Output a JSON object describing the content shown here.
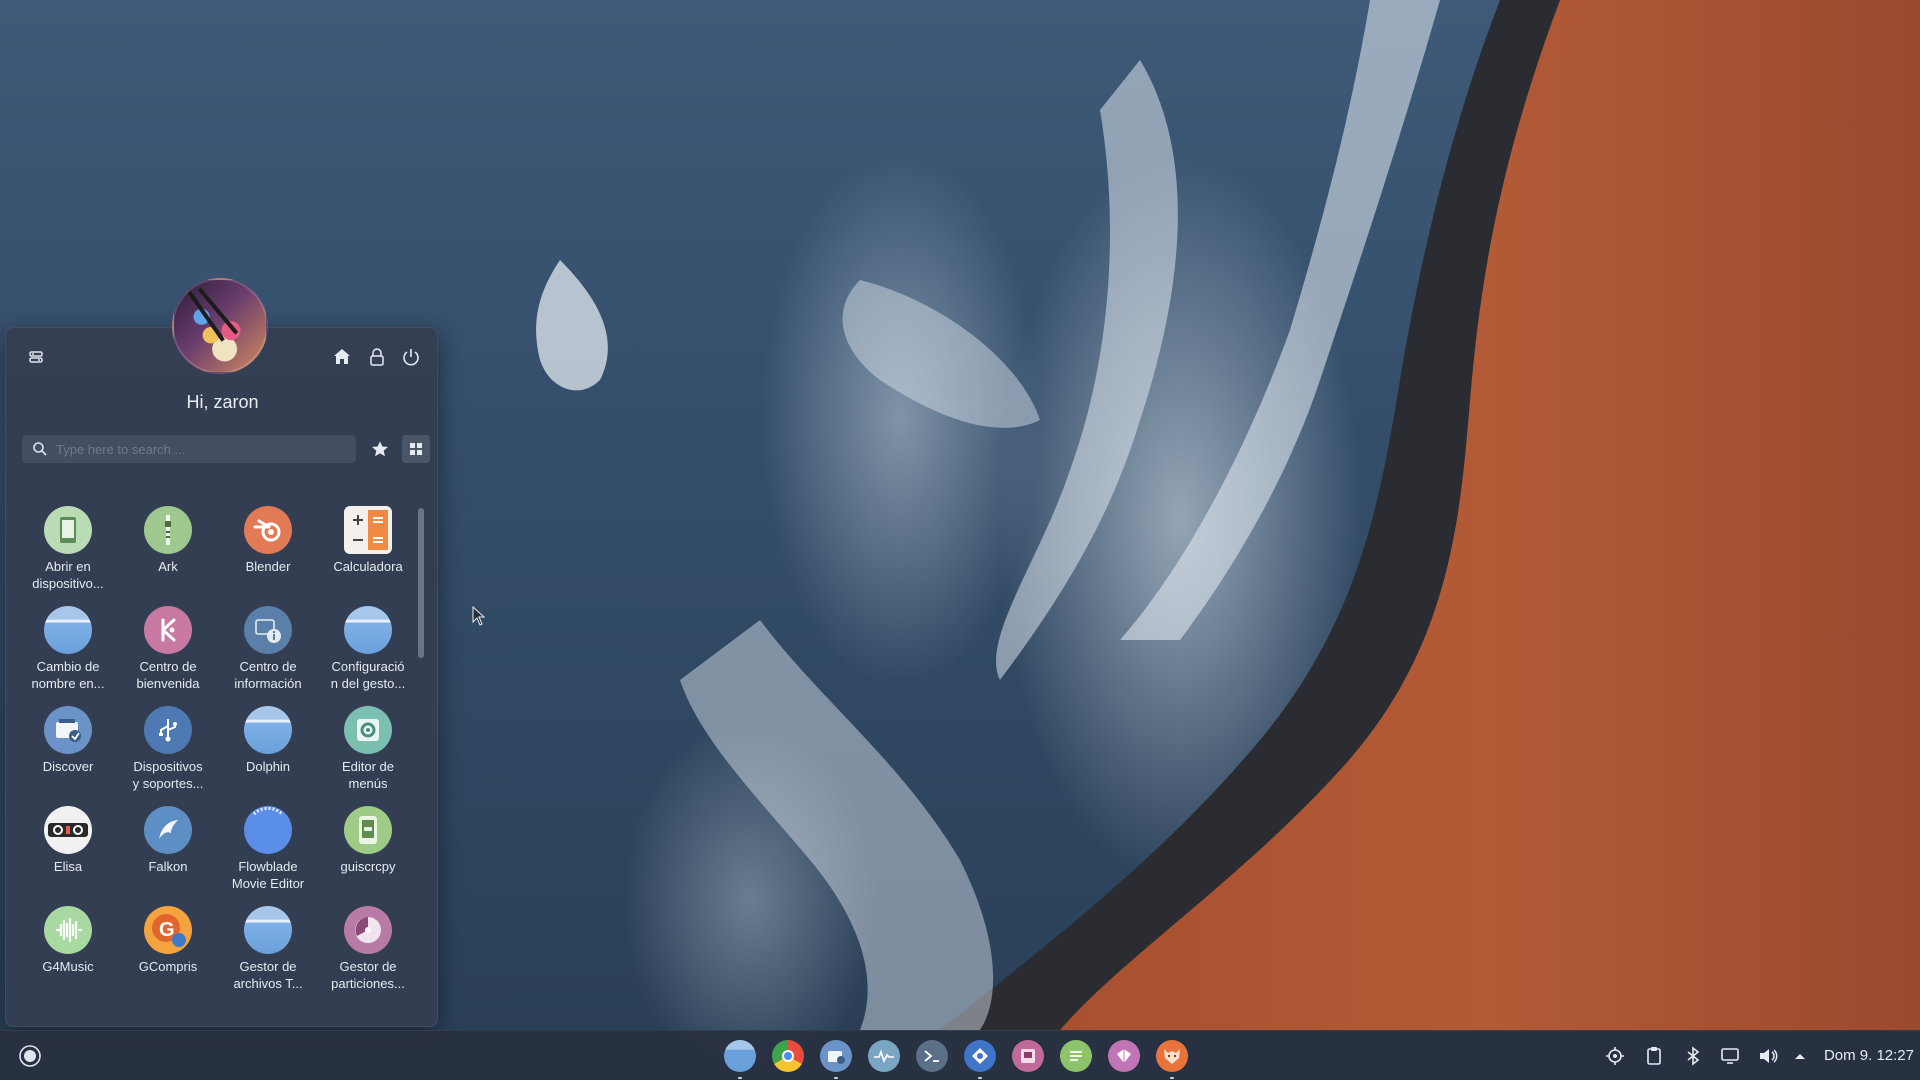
{
  "user": {
    "greeting": "Hi, zaron"
  },
  "search": {
    "placeholder": "Type here to search ..."
  },
  "menu_header_icons": [
    "panel-settings-icon",
    "home-icon",
    "lock-icon",
    "power-icon"
  ],
  "view_toggles": [
    "favorites-star-icon",
    "grid-view-icon"
  ],
  "apps": [
    {
      "label": "Abrir en\ndispositivo...",
      "icon": "kdeconnect-open-icon"
    },
    {
      "label": "Ark",
      "icon": "ark-icon"
    },
    {
      "label": "Blender",
      "icon": "blender-icon"
    },
    {
      "label": "Calculadora",
      "icon": "calculator-icon"
    },
    {
      "label": "Cambio de\nnombre en...",
      "icon": "folder-icon"
    },
    {
      "label": "Centro de\nbienvenida",
      "icon": "welcome-center-icon"
    },
    {
      "label": "Centro de\ninformación",
      "icon": "info-center-icon"
    },
    {
      "label": "Configuració\nn del gesto...",
      "icon": "folder-icon"
    },
    {
      "label": "Discover",
      "icon": "discover-icon"
    },
    {
      "label": "Dispositivos\ny soportes...",
      "icon": "usb-devices-icon"
    },
    {
      "label": "Dolphin",
      "icon": "folder-icon"
    },
    {
      "label": "Editor de\nmenús",
      "icon": "menu-editor-icon"
    },
    {
      "label": "Elisa",
      "icon": "elisa-icon"
    },
    {
      "label": "Falkon",
      "icon": "falkon-icon"
    },
    {
      "label": "Flowblade\nMovie Editor",
      "icon": "flowblade-icon"
    },
    {
      "label": "guiscrcpy",
      "icon": "guiscrcpy-icon"
    },
    {
      "label": "G4Music",
      "icon": "g4music-icon"
    },
    {
      "label": "GCompris",
      "icon": "gcompris-icon"
    },
    {
      "label": "Gestor de\narchivos T...",
      "icon": "folder-icon"
    },
    {
      "label": "Gestor de\nparticiones...",
      "icon": "partition-manager-icon"
    }
  ],
  "taskbar": {
    "launcher_icon": "app-launcher-icon",
    "apps": [
      "dolphin-icon",
      "chrome-icon",
      "discover-icon",
      "system-monitor-icon",
      "konsole-icon",
      "kdeconnect-icon",
      "media-app-icon",
      "notes-icon",
      "heroic-icon",
      "firefox-icon"
    ],
    "tray": [
      "network-settings-icon",
      "clipboard-icon",
      "bluetooth-icon",
      "display-icon",
      "volume-icon",
      "tray-expand-icon"
    ],
    "clock": "Dom 9. 12:27"
  },
  "colors": {
    "panel_bg": "#343e52",
    "taskbar_bg": "#283040",
    "text": "#e6ebf3"
  }
}
